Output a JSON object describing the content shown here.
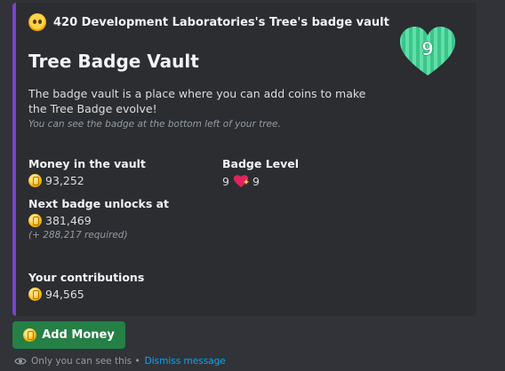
{
  "embed": {
    "accent_color": "#7b3fd6",
    "author_name": "420 Development Laboratories's Tree's badge vault",
    "author_icon": "pleading-face-emoji",
    "title": "Tree Badge Vault",
    "description": "The badge vault is a place where you can add coins to make the Tree Badge evolve!",
    "note": "You can see the badge at the bottom left of your tree.",
    "thumbnail": {
      "icon": "green-heart-badge-icon",
      "number": "9"
    },
    "fields": {
      "money": {
        "name": "Money in the vault",
        "value": "93,252"
      },
      "level": {
        "name": "Badge Level",
        "value_prefix": "9",
        "value_suffix": "9"
      },
      "next": {
        "name": "Next badge unlocks at",
        "value": "381,469",
        "note": "(+ 288,217 required)"
      },
      "contrib": {
        "name": "Your contributions",
        "value": "94,565"
      }
    }
  },
  "button": {
    "label": "Add Money",
    "color": "#248046"
  },
  "footer": {
    "text": "Only you can see this •",
    "link": "Dismiss message"
  },
  "colors": {
    "background": "#313338",
    "embed_bg": "#2b2d31",
    "link": "#00a8fc"
  }
}
